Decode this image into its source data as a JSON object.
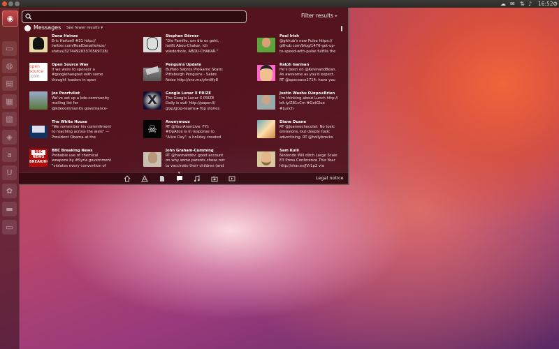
{
  "panel": {
    "time": "16:52",
    "indicators": [
      "cloud-icon",
      "mail-icon",
      "updown-icon",
      "volume-icon",
      "gear-icon"
    ]
  },
  "launcher": {
    "items": [
      {
        "name": "dash-home-icon",
        "glyph": "◉"
      },
      {
        "name": "files-icon",
        "glyph": "▭"
      },
      {
        "name": "firefox-icon",
        "glyph": "◍"
      },
      {
        "name": "writer-icon",
        "glyph": "▤"
      },
      {
        "name": "calc-icon",
        "glyph": "▦"
      },
      {
        "name": "impress-icon",
        "glyph": "▧"
      },
      {
        "name": "software-center-icon",
        "glyph": "◈"
      },
      {
        "name": "amazon-icon",
        "glyph": "a"
      },
      {
        "name": "ubuntu-one-icon",
        "glyph": "U"
      },
      {
        "name": "settings-icon",
        "glyph": "✿"
      },
      {
        "name": "workspace-icon",
        "glyph": "▬"
      },
      {
        "name": "trash-icon",
        "glyph": "▭"
      }
    ]
  },
  "search": {
    "value": "",
    "placeholder": ""
  },
  "filter_label": "Filter results",
  "category": {
    "name": "Messages",
    "fewer_label": "See fewer results",
    "fewer_arrow": "▾"
  },
  "results": [
    {
      "title": "Dana Heinze",
      "lines": [
        "Eric Hartzell #31 http://",
        "twitter.com/RealDanaHeinze/",
        "status/327449283370569728/"
      ],
      "avatar": "penguin"
    },
    {
      "title": "Stephan Dörner",
      "lines": [
        "\"Die Familie, um die es geht,",
        "heißt Abou-Chakar, ich",
        "wiederhole, ABOU-CHAKAR.\""
      ],
      "avatar": "sketch"
    },
    {
      "title": "Paul Irish",
      "lines": [
        "@github's new Pulse https://",
        "github.com/blog/1476-get-up-",
        "to-speed-with-pulse fulfills the"
      ],
      "avatar": "person-green"
    },
    {
      "title": "Open Source Way",
      "lines": [
        "If we were to sponsor a",
        "#googlehangout with some",
        "thought leaders in open"
      ],
      "avatar": "opensource"
    },
    {
      "title": "Penguins Update",
      "lines": [
        "Buffalo Sabres PreGame Skate:",
        "Pittsburgh Penguins - Sabre",
        "Noise http://sns.mx/yfmWy8"
      ],
      "avatar": "penguin-grey"
    },
    {
      "title": "Ralph Garman",
      "lines": [
        "He's been on @KevinandBean.",
        "As awesome as you'd expect.",
        "RT @spaceace1714: have you"
      ],
      "avatar": "cartoon"
    },
    {
      "title": "Jos Poortvliet",
      "lines": [
        "We've set up a kde-community",
        "mailing list for",
        "@kdeoommunity governance-"
      ],
      "avatar": "outdoor"
    },
    {
      "title": "Google Lunar X PRIZE",
      "lines": [
        "The Google Lunar X PRIZE",
        "Daily is out! http://paper.li/",
        "glxp/glxp-teams ▸ Top stories"
      ],
      "avatar": "xprize"
    },
    {
      "title": "Justin Washu Ο∂αρο≤Brien",
      "lines": [
        "I'm thinking about Lunch http://",
        "bit.ly/Z81cCm #GetGlue",
        "#Lunch"
      ],
      "avatar": "person-grey"
    },
    {
      "title": "The White House",
      "lines": [
        "\"We remember his commitment",
        "to reaching across the aisle\" —",
        "President Obama at the"
      ],
      "avatar": "whitehouse"
    },
    {
      "title": "Anonymous",
      "lines": [
        "RT @YourAnonLive: FYI:",
        "#OpAlice is in response to",
        "\"Alice Day\", a holiday created"
      ],
      "avatar": "pirate"
    },
    {
      "title": "Diane Duane",
      "lines": [
        "RT @Joannechocolat: No toxic",
        "emissions, but deeply toxic",
        "advertising. RT @hollybrocks"
      ],
      "avatar": "diane"
    },
    {
      "title": "BBC Breaking News",
      "lines": [
        "Probable use of chemical",
        "weapons by #Syria government",
        "\"violates every convention of"
      ],
      "avatar": "bbc"
    },
    {
      "title": "John Graham-Cumming",
      "lines": [
        "RT @hannahdev: good account",
        "on why some parents chose not",
        "to vaccinate their children (and"
      ],
      "avatar": "jgc"
    },
    {
      "title": "Sam Kulii",
      "lines": [
        "Nintendo Will ditch Large Scale",
        "E3 Press Conference This Year",
        "http://shar.es/JVr1p2 via"
      ],
      "avatar": "sam"
    }
  ],
  "avatar_text": {
    "opensource": [
      "open",
      "source",
      ".com"
    ],
    "bbc": [
      "BBC",
      "NEWS",
      "BREAKING"
    ]
  },
  "lenses": [
    {
      "name": "home-lens-icon",
      "active": false
    },
    {
      "name": "applications-lens-icon",
      "active": false
    },
    {
      "name": "files-lens-icon",
      "active": false
    },
    {
      "name": "social-lens-icon",
      "active": true
    },
    {
      "name": "music-lens-icon",
      "active": false
    },
    {
      "name": "photos-lens-icon",
      "active": false
    },
    {
      "name": "video-lens-icon",
      "active": false
    }
  ],
  "legal_notice": "Legal notice"
}
